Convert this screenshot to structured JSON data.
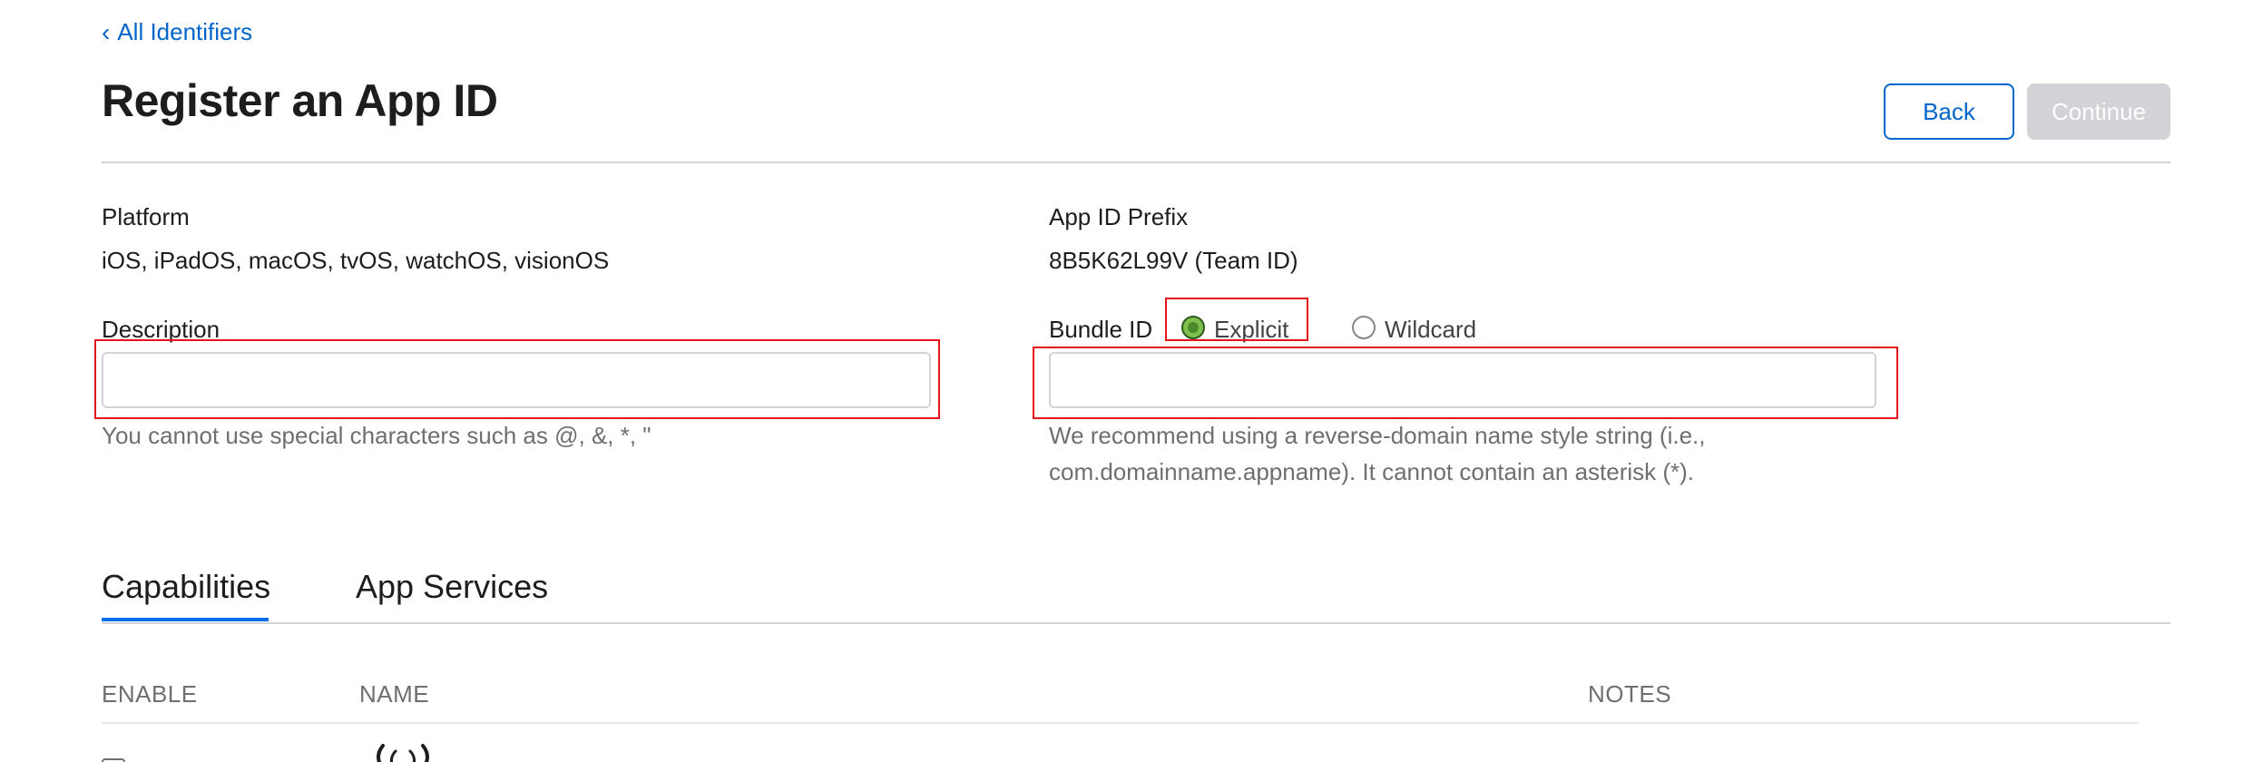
{
  "nav": {
    "back_label": "All Identifiers"
  },
  "header": {
    "title": "Register an App ID",
    "back_button": "Back",
    "continue_button": "Continue"
  },
  "platform": {
    "label": "Platform",
    "value": "iOS, iPadOS, macOS, tvOS, watchOS, visionOS"
  },
  "prefix": {
    "label": "App ID Prefix",
    "value": "8B5K62L99V (Team ID)"
  },
  "description": {
    "label": "Description",
    "value": "",
    "help": "You cannot use special characters such as @, &, *, \""
  },
  "bundle": {
    "label": "Bundle ID",
    "options": [
      {
        "label": "Explicit",
        "selected": true
      },
      {
        "label": "Wildcard",
        "selected": false
      }
    ],
    "value": "",
    "help_line1": "We recommend using a reverse-domain name style string (i.e.,",
    "help_line2": "com.domainname.appname). It cannot contain an asterisk (*)."
  },
  "tabs": [
    {
      "label": "Capabilities",
      "active": true
    },
    {
      "label": "App Services",
      "active": false
    }
  ],
  "table": {
    "columns": [
      "ENABLE",
      "NAME",
      "NOTES"
    ]
  },
  "colors": {
    "accent": "#0066cc",
    "tab_underline": "#0071e3",
    "highlight": "#e3161b",
    "disabled_button": "#d2d2d7"
  },
  "icons": [
    "chevron-left-icon",
    "radio-checked-icon",
    "radio-unchecked-icon",
    "wireless-icon"
  ]
}
